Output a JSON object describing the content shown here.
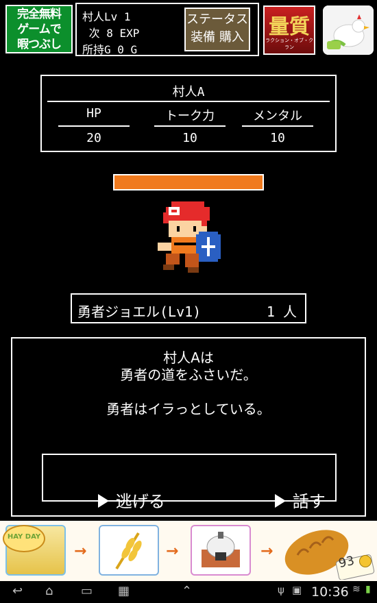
{
  "top_bar": {
    "ad_banner_lines": [
      "完全無料",
      "ゲームで",
      "暇つぶし"
    ],
    "player_level": "村人Lv 1",
    "next_exp": " 次 8 EXP",
    "gold": "所持G 0 G",
    "status_button_line1": "ステータス",
    "status_button_line2": "装備 購入",
    "ad_icon_1_title": "量質",
    "ad_icon_1_caption": "ラクション・オブ・クラン"
  },
  "enemy": {
    "name": "村人A",
    "stats": [
      {
        "label": "HP",
        "value": "20"
      },
      {
        "label": "トーク力",
        "value": "10"
      },
      {
        "label": "メンタル",
        "value": "10"
      }
    ],
    "gauge_fraction": 1.0,
    "gauge_color": "#f07a1e"
  },
  "hero": {
    "name": "勇者ジョエル(Lv1)",
    "count": "1 人"
  },
  "message": {
    "lines": [
      "村人Aは",
      "勇者の道をふさいだ。",
      "",
      "勇者はイラっとしている。"
    ],
    "commands": {
      "flee": "逃げる",
      "talk": "話す"
    }
  },
  "banner": {
    "logo": "HAY DAY",
    "price": "93"
  },
  "system_bar": {
    "time": "10:36"
  }
}
